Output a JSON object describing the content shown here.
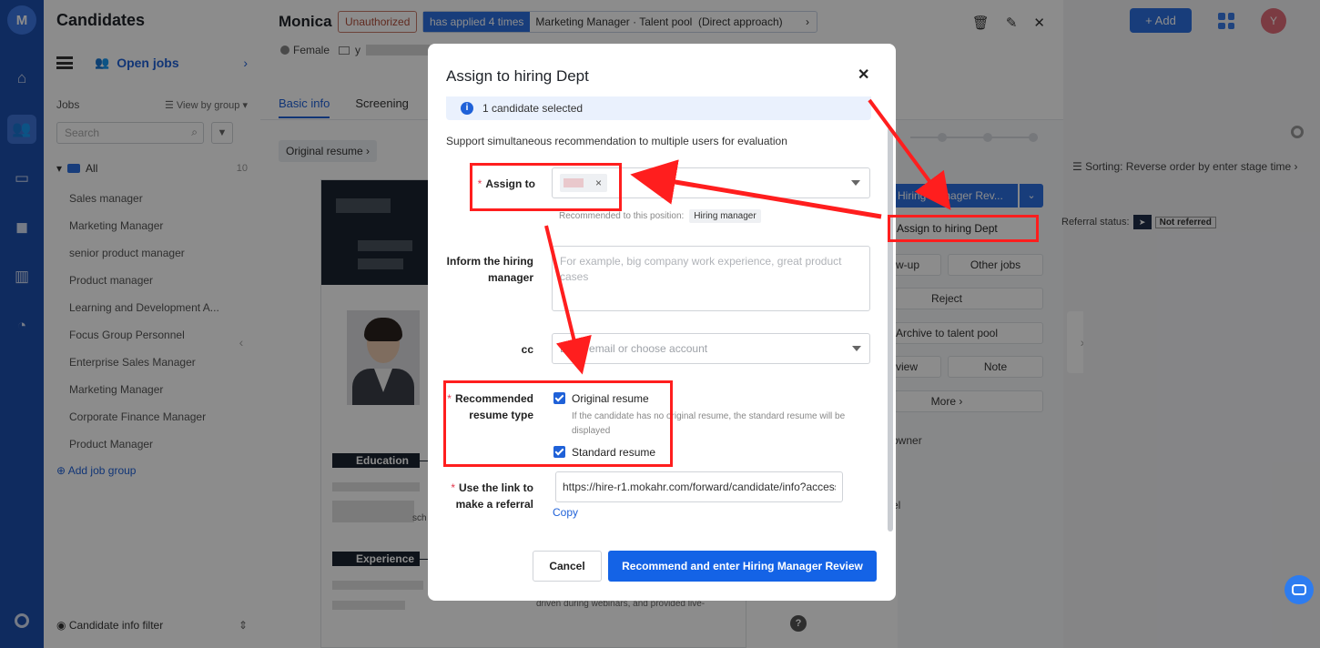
{
  "app": {
    "title": "Candidates",
    "add_label": "Add",
    "avatar_letter": "Y"
  },
  "jobs_panel": {
    "open_jobs": "Open jobs",
    "jobs_label": "Jobs",
    "view_by_group": "View by group",
    "search_placeholder": "Search",
    "all_label": "All",
    "all_count": "10",
    "items": [
      "Sales manager",
      "Marketing Manager",
      "senior product manager",
      "Product manager",
      "Learning and Development A...",
      "Focus Group Personnel",
      "Enterprise Sales Manager",
      "Marketing Manager",
      "Corporate Finance Manager",
      "Product Manager"
    ],
    "add_job_group": "Add job group",
    "candidate_filter": "Candidate info filter"
  },
  "candidate": {
    "name": "Monica",
    "status_badge": "Unauthorized",
    "applied_tag": "has applied 4 times",
    "applied_detail": "Marketing Manager · Talent pool  (Direct approach)",
    "gender": "Female",
    "email_prefix": "y",
    "tabs": [
      "Basic info",
      "Screening"
    ],
    "original_resume_btn": "Original resume",
    "resume_sections": {
      "education": "Education",
      "experience": "Experience"
    },
    "resume_snippet": "driven during webinars, and provided live-",
    "resume_school_fragment": "sch"
  },
  "side_panel": {
    "sorting": "Sorting: Reverse order by enter stage time",
    "hiring_manager_review": "Hiring Manager Rev...",
    "assign_hiring_dept": "Assign to hiring Dept",
    "referral_status_label": "Referral status:",
    "not_referred": "Not referred",
    "follow_up": "Follow-up",
    "other_jobs": "Other jobs",
    "reject": "Reject",
    "archive": "Archive to talent pool",
    "interview": "Interview",
    "note": "Note",
    "more": "More",
    "owner": "owner",
    "channel_fragment": "el"
  },
  "modal": {
    "title": "Assign to hiring Dept",
    "info": "1 candidate selected",
    "support_text": "Support simultaneous recommendation to multiple users for evaluation",
    "assign_to_label": "Assign to",
    "recommended_to_label": "Recommended to this position:",
    "recommended_pill": "Hiring manager",
    "inform_label": "Inform the hiring manager",
    "inform_placeholder": "For example, big company work experience, great product cases",
    "cc_label": "cc",
    "cc_placeholder": "Enter email or choose account",
    "resume_type_label": "Recommended resume type",
    "original_resume": "Original resume",
    "original_note": "If the candidate has no original resume, the standard resume will be displayed",
    "standard_resume": "Standard resume",
    "link_label": "Use the link to make a referral",
    "link_value": "https://hire-r1.mokahr.com/forward/candidate/info?access",
    "copy": "Copy",
    "cancel": "Cancel",
    "primary": "Recommend and enter Hiring Manager Review"
  },
  "colors": {
    "primary": "#1463e6",
    "rail": "#1d4fae",
    "annotation": "#ff1e1e",
    "required": "#e3384d"
  }
}
